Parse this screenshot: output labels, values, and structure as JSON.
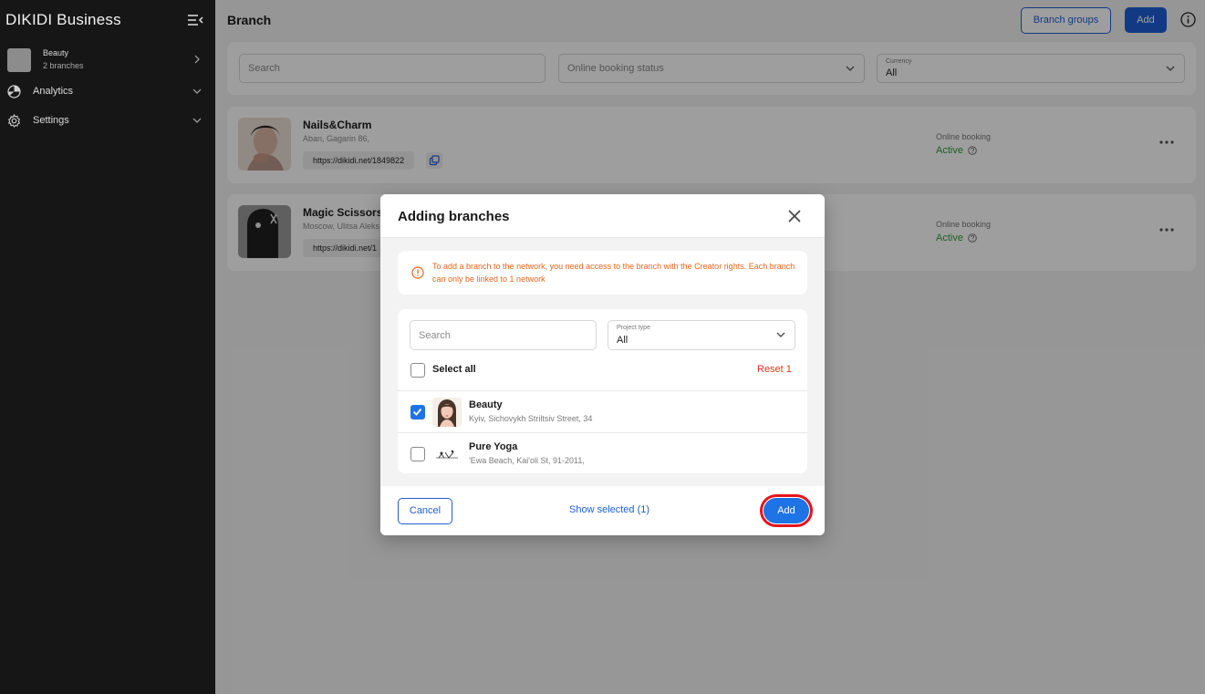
{
  "sidebar": {
    "brand": "DIKIDI Business",
    "project": {
      "name": "Beauty",
      "sub": "2 branches"
    },
    "items": [
      {
        "label": "Analytics",
        "icon": "pie-chart-icon"
      },
      {
        "label": "Settings",
        "icon": "gear-icon"
      }
    ]
  },
  "header": {
    "title": "Branch",
    "branch_groups_label": "Branch groups",
    "add_label": "Add"
  },
  "filters": {
    "search_placeholder": "Search",
    "online_booking_placeholder": "Online booking status",
    "currency_label": "Currency",
    "currency_value": "All"
  },
  "branches": [
    {
      "name": "Nails&Charm",
      "address": "Aban, Gagarin 86,",
      "url": "https://dikidi.net/1849822",
      "online_booking_label": "Online booking",
      "online_booking_value": "Active"
    },
    {
      "name": "Magic Scissors",
      "address": "Moscow, Ulitsa Aleks",
      "url": "https://dikidi.net/1",
      "online_booking_label": "Online booking",
      "online_booking_value": "Active"
    }
  ],
  "modal": {
    "title": "Adding branches",
    "notice": "To add a branch to the network, you need access to the branch with the Creator rights. Each branch can only be linked to 1 network",
    "search_placeholder": "Search",
    "project_type_label": "Project type",
    "project_type_value": "All",
    "select_all_label": "Select all",
    "reset_label": "Reset 1",
    "items": [
      {
        "name": "Beauty",
        "address": "Kyiv, Sichovykh Striltsiv Street, 34",
        "checked": true
      },
      {
        "name": "Pure Yoga",
        "address": "'Ewa Beach, Kai'oli St, 91-2011,",
        "checked": false
      }
    ],
    "cancel_label": "Cancel",
    "show_selected_label": "Show selected (1)",
    "add_label": "Add"
  },
  "colors": {
    "primary": "#1e5ed6",
    "active_green": "#2f9b3b",
    "warning_orange": "#e9651b",
    "reset_red": "#e0341e",
    "highlight_ring": "#e8141b"
  }
}
